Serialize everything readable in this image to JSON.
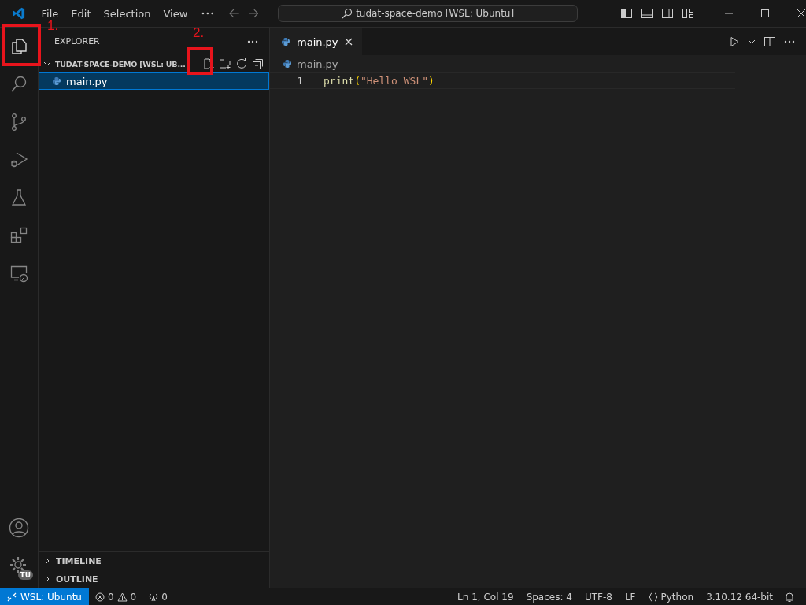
{
  "title_bar": {
    "menu": [
      "File",
      "Edit",
      "Selection",
      "View"
    ],
    "command_center": "tudat-space-demo [WSL: Ubuntu]"
  },
  "activity_bar": [
    {
      "kind": "explorer",
      "selected": true
    },
    {
      "kind": "search",
      "selected": false
    },
    {
      "kind": "source-control",
      "selected": false
    },
    {
      "kind": "run",
      "selected": false
    },
    {
      "kind": "testing",
      "selected": false
    },
    {
      "kind": "extensions",
      "selected": false
    },
    {
      "kind": "remote",
      "selected": false
    }
  ],
  "account_badge": "TU",
  "sidebar": {
    "title": "EXPLORER",
    "folder": "TUDAT-SPACE-DEMO [WSL: UB...",
    "files": [
      {
        "name": "main.py",
        "selected": true
      }
    ],
    "sections": [
      {
        "label": "TIMELINE",
        "expanded": false
      },
      {
        "label": "OUTLINE",
        "expanded": false
      }
    ]
  },
  "editor": {
    "tabs": [
      {
        "label": "main.py",
        "selected": true
      }
    ],
    "breadcrumb": "main.py",
    "lines": [
      {
        "number": "1",
        "tokens": [
          {
            "text": "print",
            "kind": "function"
          },
          {
            "text": "(",
            "kind": "bracket"
          },
          {
            "text": "\"Hello WSL\"",
            "kind": "string"
          },
          {
            "text": ")",
            "kind": "bracket"
          }
        ]
      }
    ]
  },
  "status_bar": {
    "remote": "WSL: Ubuntu",
    "errors": "0",
    "warnings": "0",
    "ports": "0",
    "right": [
      "Ln 1, Col 19",
      "Spaces: 4",
      "UTF-8",
      "LF"
    ],
    "language": "Python",
    "interpreter": "3.10.12 64-bit"
  },
  "annotations": [
    {
      "label": "1."
    },
    {
      "label": "2."
    }
  ]
}
